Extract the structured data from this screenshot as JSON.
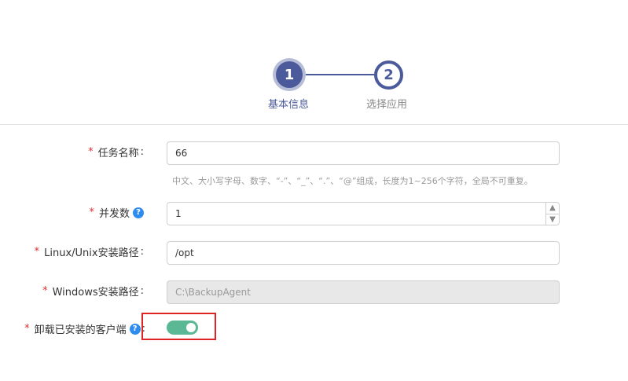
{
  "stepper": {
    "steps": [
      {
        "number": "1",
        "label": "基本信息"
      },
      {
        "number": "2",
        "label": "选择应用"
      }
    ]
  },
  "form": {
    "task_name": {
      "label": "任务名称",
      "value": "66",
      "hint": "中文、大小写字母、数字、“-”、“_”、“.”、“@”组成，长度为1~256个字符，全局不可重复。"
    },
    "concurrency": {
      "label": "并发数",
      "value": "1"
    },
    "linux_path": {
      "label": "Linux/Unix安装路径",
      "value": "/opt"
    },
    "windows_path": {
      "label": "Windows安装路径",
      "value": "C:\\BackupAgent"
    },
    "uninstall": {
      "label": "卸载已安装的客户端",
      "enabled": true
    }
  },
  "colors": {
    "primary": "#4a5a9a",
    "toggle_on": "#5bb895",
    "required": "#e03030",
    "highlight": "#e02424"
  }
}
